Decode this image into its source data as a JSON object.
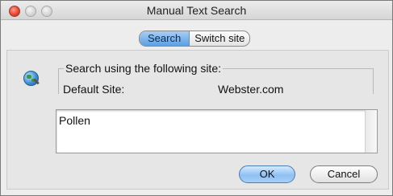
{
  "window": {
    "title": "Manual Text Search"
  },
  "tabs": [
    {
      "label": "Search",
      "active": true
    },
    {
      "label": "Switch site",
      "active": false
    }
  ],
  "site_group": {
    "legend": "Search using the following site:",
    "label": "Default Site:",
    "value": "Webster.com"
  },
  "query": {
    "value": "Pollen"
  },
  "buttons": {
    "ok_label": "OK",
    "cancel_label": "Cancel"
  },
  "icons": {
    "search_icon": "globe-search-icon"
  },
  "colors": {
    "accent": "#5b9fe4",
    "close_button": "#e0442f"
  }
}
